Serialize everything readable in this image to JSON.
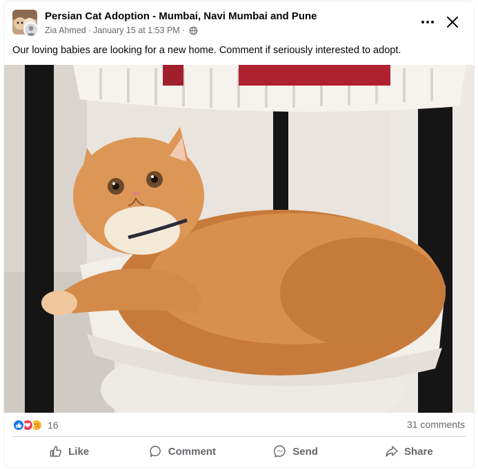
{
  "post": {
    "group_name": "Persian Cat Adoption - Mumbai, Navi Mumbai and Pune",
    "author": "Zia Ahmed",
    "separator": "·",
    "timestamp": "January 15 at 1:53 PM",
    "audience_icon": "globe-icon",
    "caption": "Our loving babies are looking for a new home. Comment if seriously interested to adopt.",
    "photo_alt": "Orange fluffy Persian cat lying in a white plastic basket rack"
  },
  "reactions": {
    "icons": [
      "like-reaction-icon",
      "love-reaction-icon",
      "care-reaction-icon"
    ],
    "count": "16",
    "comments": "31 comments"
  },
  "actions": {
    "like": "Like",
    "comment": "Comment",
    "send": "Send",
    "share": "Share"
  },
  "colors": {
    "like_blue": "#1877f2",
    "love_red": "#f33e58",
    "care_yellow": "#f7b928",
    "secondary_text": "#65676b"
  }
}
